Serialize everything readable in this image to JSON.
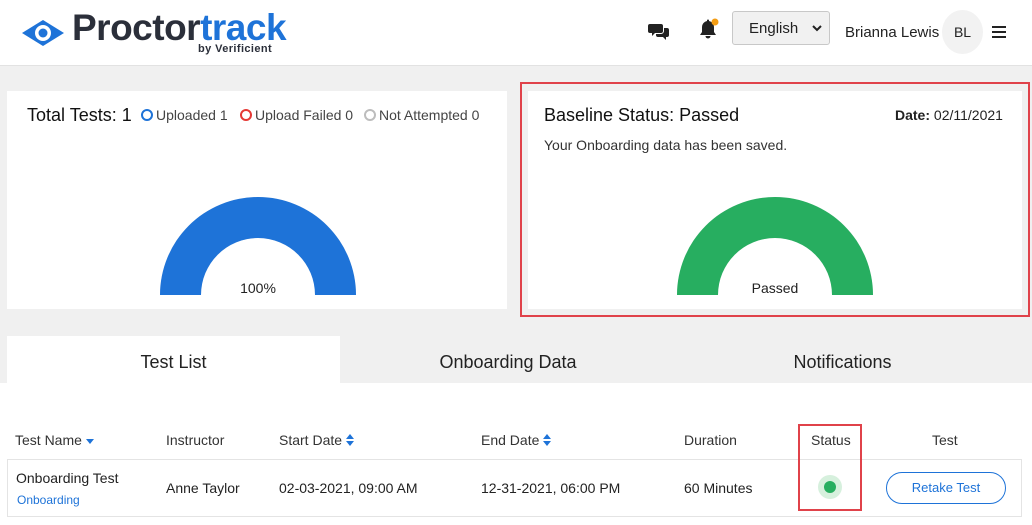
{
  "header": {
    "logo_main_1": "Proctor",
    "logo_main_2": "track",
    "logo_sub": "by Verificient",
    "language": "English",
    "user_name": "Brianna Lewis",
    "user_initials": "BL"
  },
  "summary": {
    "total_label": "Total Tests: 1",
    "legend": [
      {
        "label": "Uploaded 1",
        "color": "#1e73d8"
      },
      {
        "label": "Upload Failed 0",
        "color": "#e53935"
      },
      {
        "label": "Not Attempted 0",
        "color": "#bdbdbd"
      }
    ],
    "gauge_label": "100%",
    "gauge_fraction": 1.0,
    "gauge_color": "#1e73d8"
  },
  "baseline": {
    "title": "Baseline Status: Passed",
    "date_label": "Date:",
    "date_value": "02/11/2021",
    "message": "Your Onboarding data has been saved.",
    "gauge_label": "Passed",
    "gauge_fraction": 1.0,
    "gauge_color": "#27ae60"
  },
  "tabs": [
    {
      "label": "Test List",
      "active": true
    },
    {
      "label": "Onboarding Data",
      "active": false
    },
    {
      "label": "Notifications",
      "active": false
    }
  ],
  "table": {
    "headers": {
      "test_name": "Test Name",
      "instructor": "Instructor",
      "start_date": "Start Date",
      "end_date": "End Date",
      "duration": "Duration",
      "status": "Status",
      "test": "Test"
    },
    "row": {
      "test_name": "Onboarding Test",
      "test_type": "Onboarding",
      "instructor": "Anne Taylor",
      "start_date": "02-03-2021, 09:00 AM",
      "end_date": "12-31-2021, 06:00 PM",
      "duration": "60 Minutes",
      "status_color": "#27ae60",
      "action": "Retake Test"
    }
  },
  "colors": {
    "accent": "#1e73d8",
    "success": "#27ae60",
    "highlight": "#e0424a",
    "notification_dot": "#f39c12"
  }
}
